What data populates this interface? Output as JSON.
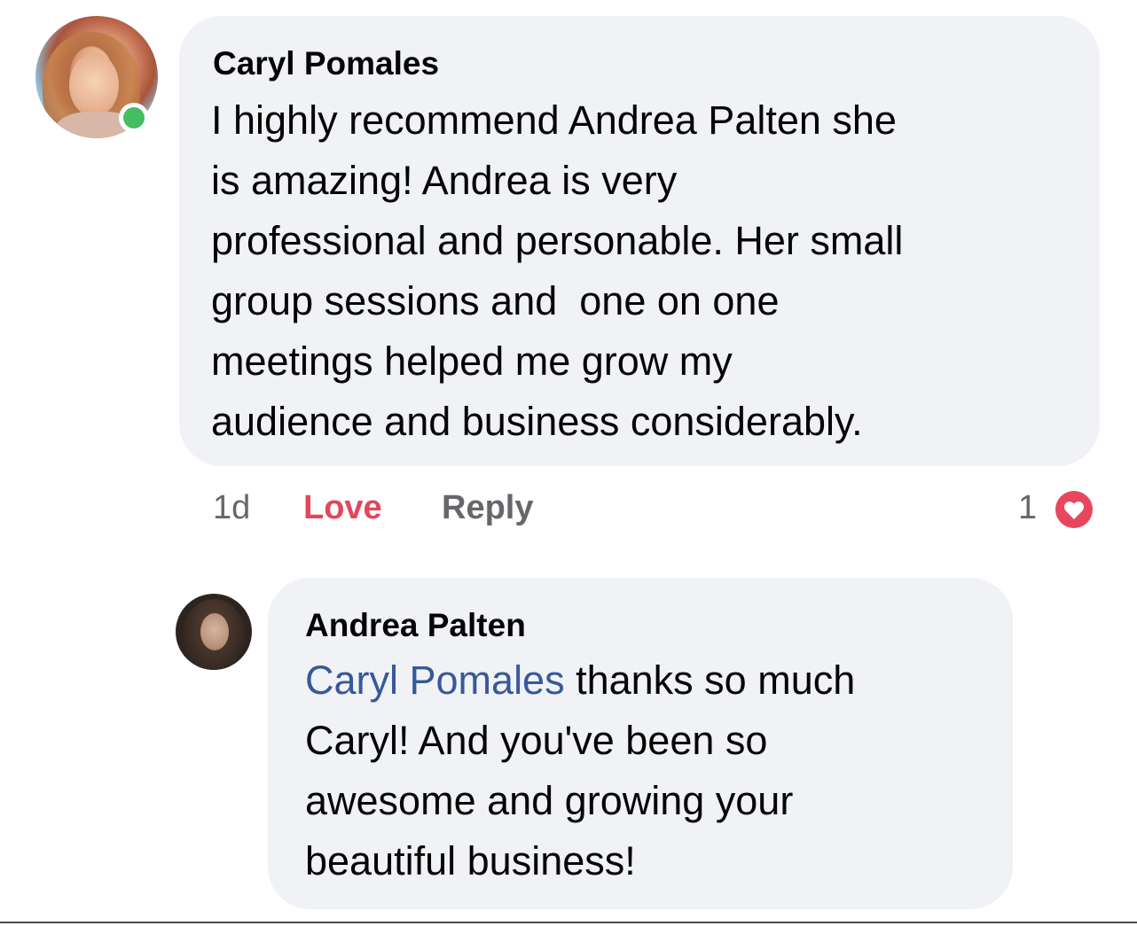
{
  "comment": {
    "author": "Caryl Pomales",
    "lines": [
      "I highly recommend Andrea Palten she",
      "is amazing! Andrea is very",
      "professional and personable. Her small",
      "group sessions and  one on one",
      "meetings helped me grow my",
      "audience and business considerably."
    ],
    "time": "1d",
    "love_label": "Love",
    "reply_label": "Reply",
    "reaction_count": "1",
    "reaction_icon": "heart-icon",
    "online_status_color": "#45bd62"
  },
  "reply": {
    "author": "Andrea Palten",
    "mention": "Caryl Pomales",
    "lines": [
      " thanks so much",
      "Caryl! And you've been so",
      "awesome and growing your",
      "beautiful business!"
    ]
  },
  "colors": {
    "bubble": "#f0f2f5",
    "love": "#e2475d",
    "mention": "#385898",
    "meta": "#65676b"
  }
}
